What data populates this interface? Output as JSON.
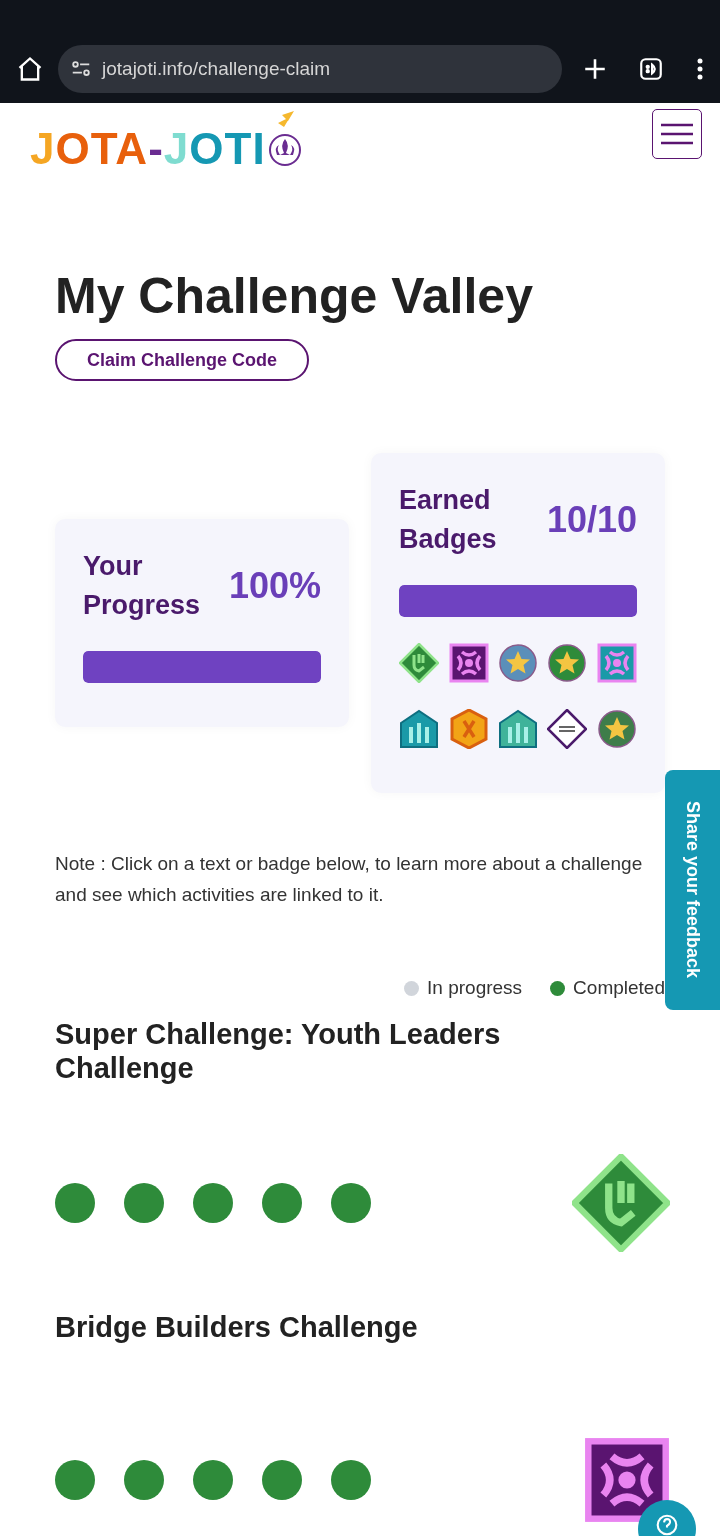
{
  "browser": {
    "url": "jotajoti.info/challenge-claim"
  },
  "logo": {
    "text": "JOTA-JOTI"
  },
  "page": {
    "title": "My Challenge Valley",
    "claim_button": "Claim Challenge Code"
  },
  "progress_card": {
    "title": "Your Progress",
    "value": "100%",
    "level": 1
  },
  "badges_card": {
    "title": "Earned Badges",
    "value": "10/10",
    "level": 1,
    "badges": [
      {
        "kind": "diamond",
        "color": "#2e8b3a"
      },
      {
        "kind": "square",
        "color": "#5a1470"
      },
      {
        "kind": "circle",
        "color": "#5b8fb9"
      },
      {
        "kind": "circle",
        "color": "#2e8b3a"
      },
      {
        "kind": "square",
        "color": "#1a9aa8"
      },
      {
        "kind": "house",
        "color": "#1a9aa8"
      },
      {
        "kind": "hexagon",
        "color": "#f2a416"
      },
      {
        "kind": "house",
        "color": "#3fb39a"
      },
      {
        "kind": "diamond",
        "color": "#ffffff"
      },
      {
        "kind": "circle",
        "color": "#3e7d4a"
      }
    ]
  },
  "note": "Note : Click on a text or badge below, to learn more about a challenge and see which activities are linked to it.",
  "legend": [
    {
      "label": "In progress",
      "color": "#d1d5db"
    },
    {
      "label": "Completed",
      "color": "#2e8b3a"
    }
  ],
  "feedback_tab": "Share your feedback",
  "challenges": [
    {
      "title": "Super Challenge: Youth Leaders Challenge",
      "badge": {
        "kind": "diamond",
        "color": "#2e8b3a"
      },
      "dots": [
        {
          "completed": true
        },
        {
          "completed": true
        },
        {
          "completed": true
        },
        {
          "completed": true
        },
        {
          "completed": true
        }
      ]
    },
    {
      "title": "Bridge Builders Challenge",
      "badge": {
        "kind": "square",
        "color": "#5a1470"
      },
      "dots": [
        {
          "completed": true
        },
        {
          "completed": true
        },
        {
          "completed": true
        },
        {
          "completed": true
        },
        {
          "completed": true
        }
      ]
    }
  ]
}
